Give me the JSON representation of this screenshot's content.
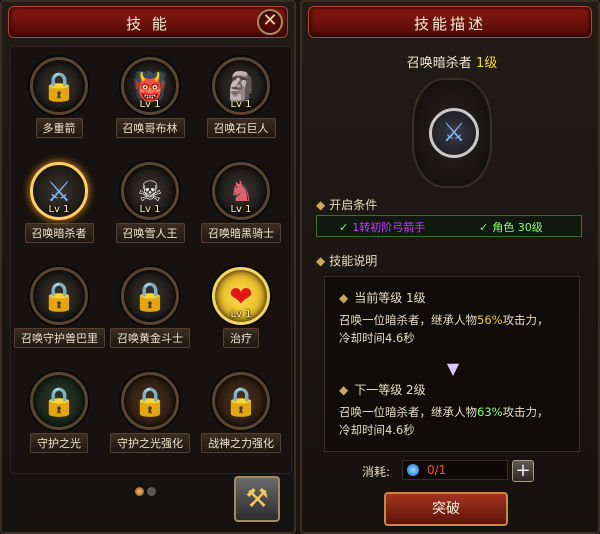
{
  "left_panel": {
    "title": "技 能",
    "close_label": "✕"
  },
  "skills": [
    {
      "name": "多重箭",
      "level": "",
      "icon": "lock-icon",
      "glyph": "🔒",
      "tone": "lock",
      "ring": "",
      "col": 0,
      "row": 0
    },
    {
      "name": "召唤哥布林",
      "level": "Lv 1",
      "icon": "goblin-icon",
      "glyph": "👹",
      "tone": "portrait-goblin",
      "ring": "",
      "col": 1,
      "row": 0
    },
    {
      "name": "召唤石巨人",
      "level": "Lv 1",
      "icon": "stone-giant-icon",
      "glyph": "🗿",
      "tone": "portrait-stone",
      "ring": "",
      "col": 2,
      "row": 0
    },
    {
      "name": "召唤暗杀者",
      "level": "Lv 1",
      "icon": "assassin-icon",
      "glyph": "⚔",
      "tone": "portrait-assassin",
      "ring": "sel",
      "col": 0,
      "row": 1
    },
    {
      "name": "召唤雪人王",
      "level": "Lv 1",
      "icon": "yeti-icon",
      "glyph": "☠",
      "tone": "portrait-yeti",
      "ring": "",
      "col": 1,
      "row": 1
    },
    {
      "name": "召唤暗黑骑士",
      "level": "Lv 1",
      "icon": "dark-knight-icon",
      "glyph": "♞",
      "tone": "portrait-black",
      "ring": "",
      "col": 2,
      "row": 1
    },
    {
      "name": "召唤守护兽巴里",
      "level": "",
      "icon": "lock-icon",
      "glyph": "🔒",
      "tone": "lock",
      "ring": "",
      "col": 0,
      "row": 2
    },
    {
      "name": "召唤黄金斗士",
      "level": "",
      "icon": "lock-icon",
      "glyph": "🔒",
      "tone": "lock",
      "ring": "",
      "col": 1,
      "row": 2
    },
    {
      "name": "治疗",
      "level": "Lv 1",
      "icon": "heart-icon",
      "glyph": "❤",
      "tone": "heart",
      "ring": "gold",
      "col": 2,
      "row": 2
    },
    {
      "name": "守护之光",
      "level": "",
      "icon": "lock-icon",
      "glyph": "🔒",
      "tone": "lock",
      "ring": "green",
      "col": 0,
      "row": 3
    },
    {
      "name": "守护之光强化",
      "level": "",
      "icon": "lock-icon",
      "glyph": "🔒",
      "tone": "lock",
      "ring": "brown",
      "col": 1,
      "row": 3
    },
    {
      "name": "战神之力强化",
      "level": "",
      "icon": "lock-icon",
      "glyph": "🔒",
      "tone": "lock",
      "ring": "brown",
      "col": 2,
      "row": 3
    }
  ],
  "pager": {
    "current": 1,
    "total": 2
  },
  "right_panel": {
    "title": "技能描述",
    "skill_name": "召唤暗杀者",
    "skill_level": "1级",
    "requirements_header": "开启条件",
    "req_1": "1转初阶弓箭手",
    "req_2": "角色 30级",
    "desc_header": "技能说明",
    "current_header": "当前等级 1级",
    "current_text_a": "召唤一位暗杀者，继承人物",
    "current_pct": "56%",
    "current_text_b": "攻击力，",
    "current_text_c": "冷却时间4.6秒",
    "next_header": "下一等级 2级",
    "next_text_a": "召唤一位暗杀者，继承人物",
    "next_pct": "63%",
    "next_text_b": "攻击力，",
    "next_text_c": "冷却时间4.6秒",
    "cost_label": "消耗:",
    "cost_value": "0/1",
    "plus_label": "+",
    "break_label": "突破"
  }
}
